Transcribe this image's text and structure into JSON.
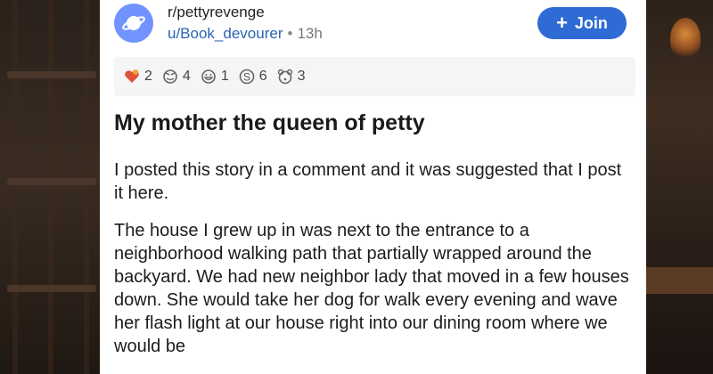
{
  "post": {
    "subreddit": "r/pettyrevenge",
    "author": "u/Book_devourer",
    "separator": "•",
    "time": "13h",
    "join_label": "Join",
    "join_plus": "+",
    "awards": [
      {
        "icon": "heart-award-icon",
        "count": "2",
        "color": "#e0533b"
      },
      {
        "icon": "face-award-icon",
        "count": "4",
        "color": "#666"
      },
      {
        "icon": "laugh-award-icon",
        "count": "1",
        "color": "#666"
      },
      {
        "icon": "coin-award-icon",
        "count": "6",
        "color": "#666"
      },
      {
        "icon": "bear-award-icon",
        "count": "3",
        "color": "#666"
      }
    ],
    "title": "My mother the queen of petty",
    "paragraphs": [
      "I posted this story in a comment and it was suggested that I post it here.",
      "The house I grew up in was next to the entrance to a neighborhood walking path that partially wrapped around the backyard. We had new neighbor lady that moved in a few houses down. She would take her dog for walk every evening and wave her flash light at our house right into our dining room where we would be"
    ]
  },
  "colors": {
    "join_bg": "#2f6bd5",
    "author": "#2a63b3",
    "sub_avatar": "#7193ff"
  }
}
